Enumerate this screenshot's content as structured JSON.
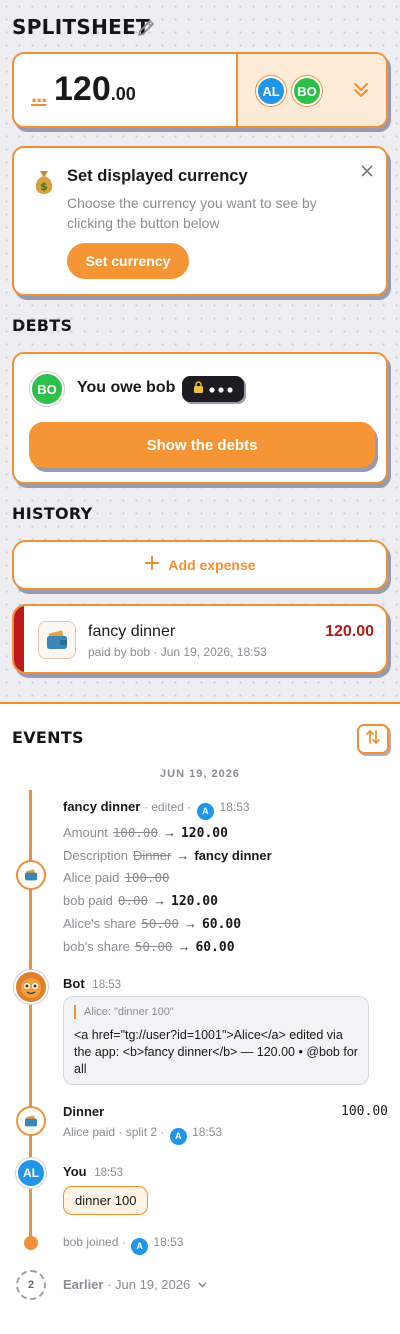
{
  "app": {
    "title": "SPLITSHEET"
  },
  "balance": {
    "currency_dots": "...",
    "amount": "120",
    "cents": ".00",
    "avatars": [
      "AL",
      "BO"
    ]
  },
  "currency_card": {
    "title": "Set displayed currency",
    "description": "Choose the currency you want to see by clicking the button below",
    "button": "Set currency"
  },
  "debts": {
    "heading": "DEBTS",
    "avatar": "BO",
    "text": "You owe bob",
    "button": "Show the debts"
  },
  "history": {
    "heading": "HISTORY",
    "add_label": "Add expense",
    "expense": {
      "title": "fancy dinner",
      "meta": "paid by bob · Jun 19, 2026, 18:53",
      "amount": "120.00"
    }
  },
  "events": {
    "heading": "EVENTS",
    "date": "JUN 19, 2026",
    "edit": {
      "title": "fancy dinner",
      "sep": "· edited ·",
      "author_avatar": "A",
      "time": "18:53",
      "changes": [
        {
          "label": "Amount",
          "old": "100.00",
          "arrow": "→",
          "new": "120.00"
        },
        {
          "label": "Description",
          "old": "Dinner",
          "arrow": "→",
          "new": "fancy dinner"
        },
        {
          "label": "Alice paid",
          "old": "100.00",
          "arrow": "",
          "new": ""
        },
        {
          "label": "bob paid",
          "old": "0.00",
          "arrow": "→",
          "new": "120.00"
        },
        {
          "label": "Alice's share",
          "old": "50.00",
          "arrow": "→",
          "new": "60.00"
        },
        {
          "label": "bob's share",
          "old": "50.00",
          "arrow": "→",
          "new": "60.00"
        }
      ]
    },
    "bot": {
      "name": "Bot",
      "time": "18:53",
      "quote": "Alice: \"dinner 100\"",
      "message": "<a href=\"tg://user?id=1001\">Alice</a> edited via the app: <b>fancy dinner</b> — 120.00 • @bob for all"
    },
    "dinner": {
      "title": "Dinner",
      "amount": "100.00",
      "meta": "Alice paid · split 2 ·",
      "avatar": "A",
      "time": "18:53"
    },
    "you": {
      "avatar": "AL",
      "name": "You",
      "time": "18:53",
      "message": "dinner 100"
    },
    "joined": {
      "text": "bob joined ·",
      "avatar": "A",
      "time": "18:53"
    },
    "earlier": {
      "count": "2",
      "label": "Earlier",
      "date": "· Jun 19, 2026"
    }
  }
}
